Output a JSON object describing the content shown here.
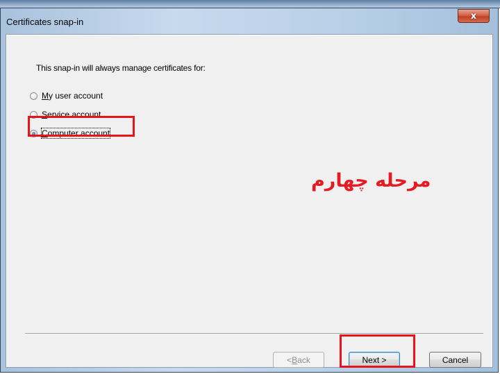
{
  "window": {
    "title": "Certificates snap-in",
    "close_glyph": "x"
  },
  "intro_text": "This snap-in will always manage certificates for:",
  "options": [
    {
      "prefix": "",
      "mnemonic": "M",
      "rest": "y user account",
      "selected": false
    },
    {
      "prefix": "",
      "mnemonic": "S",
      "rest": "ervice account",
      "selected": false
    },
    {
      "prefix": "",
      "mnemonic": "C",
      "rest": "omputer account",
      "selected": true
    }
  ],
  "annotation": "مرحله چهارم",
  "buttons": {
    "back": {
      "pre": "< ",
      "mnemonic": "B",
      "rest": "ack",
      "enabled": false
    },
    "next": {
      "label": "Next >"
    },
    "cancel": {
      "label": "Cancel"
    }
  },
  "colors": {
    "highlight": "#e8141c",
    "annotation": "#e51b23",
    "titlebar": "#b8cfe7",
    "close": "#c13f27"
  }
}
